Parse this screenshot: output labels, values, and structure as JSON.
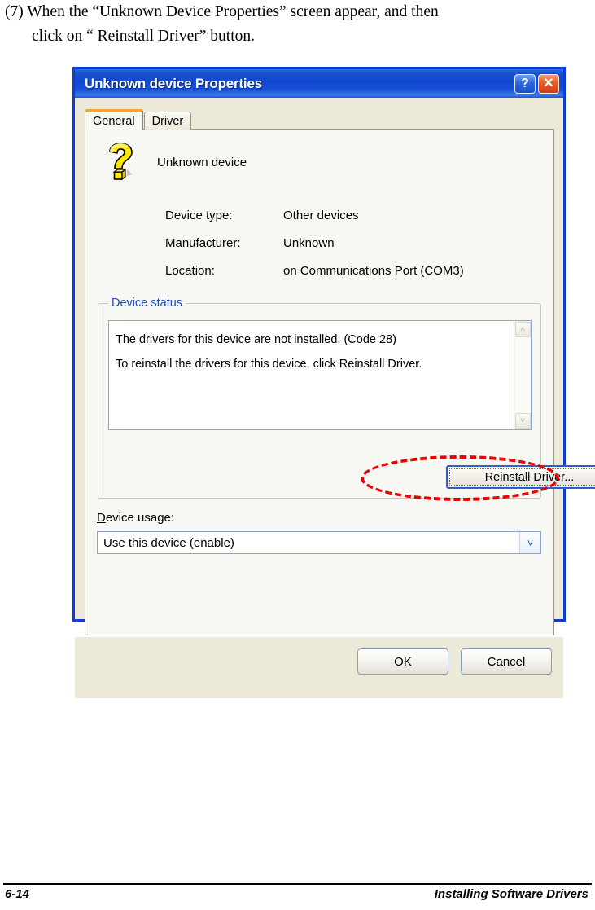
{
  "page": {
    "instruction_line1": "(7) When the “Unknown Device Properties” screen appear, and then",
    "instruction_line2": "click on “ Reinstall Driver” button.",
    "page_number": "6-14",
    "footer_title": "Installing Software Drivers"
  },
  "dialog": {
    "title": "Unknown device Properties",
    "help_button": "?",
    "close_button": "✕",
    "tabs": [
      {
        "label": "General",
        "active": true
      },
      {
        "label": "Driver",
        "active": false
      }
    ],
    "device": {
      "icon": "question-mark-device-icon",
      "name": "Unknown device",
      "properties": [
        {
          "label": "Device type:",
          "value": "Other devices"
        },
        {
          "label": "Manufacturer:",
          "value": "Unknown"
        },
        {
          "label": "Location:",
          "value": "on Communications Port (COM3)"
        }
      ]
    },
    "device_status": {
      "group_label": "Device status",
      "line1": "The drivers for this device are not installed. (Code 28)",
      "line2": "To reinstall the drivers for this device, click Reinstall Driver.",
      "scroll_up_icon": "˄",
      "scroll_down_icon": "˅",
      "reinstall_button": "Reinstall Driver..."
    },
    "device_usage": {
      "label_accel": "D",
      "label_rest": "evice usage:",
      "selected_value": "Use this device (enable)",
      "dropdown_icon": "˅"
    },
    "footer_buttons": [
      {
        "label": "OK"
      },
      {
        "label": "Cancel"
      }
    ]
  },
  "annotation": {
    "shape": "red-dashed-ellipse",
    "color": "#ee0000",
    "targets": "Reinstall Driver... button"
  },
  "colors": {
    "titlebar_blue": "#0a3fd0",
    "dialog_face": "#ece9d8",
    "panel_face": "#f7f7f3",
    "group_label_blue": "#1e4fc4",
    "tab_accent_orange": "#f0a630",
    "annotation_red": "#ee0000"
  }
}
